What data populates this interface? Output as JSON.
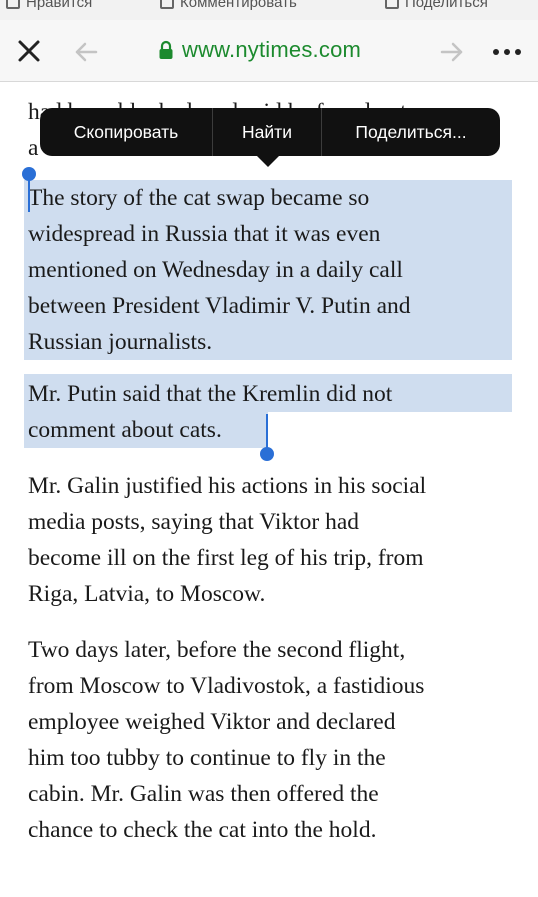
{
  "facebook_bar": {
    "like_label": "Нравится",
    "comment_label": "Комментировать",
    "share_label": "Поделиться"
  },
  "browser": {
    "url": "www.nytimes.com",
    "close_icon": "close-icon",
    "back_icon": "back-arrow-icon",
    "forward_icon": "forward-arrow-icon",
    "more_icon": "more-icon",
    "lock_icon": "lock-icon",
    "url_color": "#1c8a2e"
  },
  "edit_menu": {
    "copy_label": "Скопировать",
    "find_label": "Найти",
    "share_label": "Поделиться..."
  },
  "article": {
    "partial_line_1": "had been blocked, and said he found out",
    "partial_line_2": "a",
    "para1_lines": [
      "The story of the cat swap became so",
      "widespread in Russia that it was even",
      "mentioned on Wednesday in a daily call",
      "between President Vladimir V. Putin and",
      "Russian journalists."
    ],
    "para2_lines": [
      "Mr. Putin said that the Kremlin did not",
      "comment about cats."
    ],
    "para3_lines": [
      "Mr. Galin justified his actions in his social",
      "media posts, saying that Viktor had",
      "become ill on the first leg of his trip, from",
      "Riga, Latvia, to Moscow."
    ],
    "para4_lines": [
      "Two days later, before the second flight,",
      "from Moscow to Vladivostok, a fastidious",
      "employee weighed Viktor and declared",
      "him too tubby to continue to fly in the",
      "cabin. Mr. Galin was then offered the",
      "chance to check the cat into the hold."
    ]
  },
  "selection_color": "#cfddef",
  "handle_color": "#2a6fd6"
}
